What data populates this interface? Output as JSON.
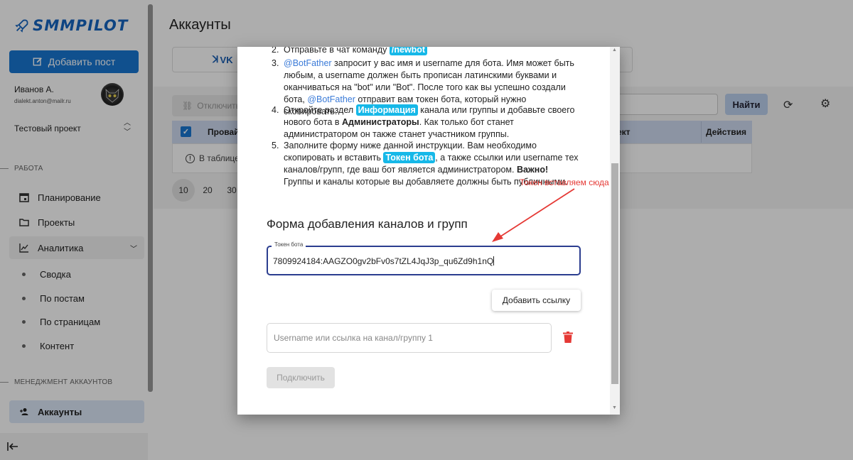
{
  "sidebar": {
    "logo_text": "SMMPILOT",
    "add_post_label": "Добавить пост",
    "user": {
      "name": "Иванов А.",
      "email": "dialekt.anton@mailr.ru"
    },
    "project_name": "Тестовый проект",
    "section_work": "РАБОТА",
    "section_accounts": "МЕНЕДЖМЕНТ АККАУНТОВ",
    "items": [
      {
        "label": "Планирование",
        "icon": "calendar-icon"
      },
      {
        "label": "Проекты",
        "icon": "folder-icon"
      },
      {
        "label": "Аналитика",
        "icon": "chart-icon"
      },
      {
        "label": "Сводка"
      },
      {
        "label": "По постам"
      },
      {
        "label": "По страницам"
      },
      {
        "label": "Контент"
      },
      {
        "label": "Аккаунты",
        "icon": "add-user-icon"
      }
    ]
  },
  "main": {
    "title": "Аккаунты",
    "tab_label": "VK",
    "disconnect_label": "Отключить",
    "find_label": "Найти",
    "table": {
      "col_provider": "Провай",
      "col_project": "ект",
      "col_actions": "Действия",
      "empty_text": "В таблице"
    },
    "pager": [
      "10",
      "20",
      "30"
    ]
  },
  "modal": {
    "step2_num": "2.",
    "step2_text": "Отправьте в чат команду ",
    "step2_cmd": "/newbot",
    "step3_num": "3.",
    "step3_link": "@BotFather",
    "step3_text": " запросит у вас имя и username для бота. Имя может быть любым, а username должен быть прописан латинскими буквами и оканчиваться на \"bot\" или \"Bot\". После того как вы успешно создали бота, ",
    "step3_link2": "@BotFather",
    "step3_text2": " отправит вам токен бота, который нужно скопировать.",
    "step4_num": "4.",
    "step4_a": "Откройте раздел ",
    "step4_hl": "Информация",
    "step4_b": " канала или группы и добавьте своего нового бота в ",
    "step4_bold": "Администраторы",
    "step4_c": ". Как только бот станет администратором он также станет участником группы.",
    "step5_num": "5.",
    "step5_a": "Заполните форму ниже данной инструкции. Вам необходимо скопировать и вставить ",
    "step5_hl": "Токен бота",
    "step5_b": ", а также ссылки или username тех каналов/групп, где ваш бот является администратором. ",
    "step5_bold": "Важно!",
    "step5_c": " Группы и каналы которые вы добавляете должны быть публичными.",
    "annotation": "Токен вставляем сюда",
    "form_title": "Форма добавления каналов и групп",
    "token_label": "Токен бота",
    "token_value": "7809924184:AAGZO0gv2bFv0s7tZL4JqJ3p_qu6Zd9h1nQ",
    "add_link_label": "Добавить ссылку",
    "channel_placeholder": "Username или ссылка на канал/группу 1",
    "connect_label": "Подключить"
  },
  "colors": {
    "primary": "#1976d2",
    "highlight": "#16b8e8",
    "annotation": "#e53935",
    "danger": "#e53935"
  }
}
